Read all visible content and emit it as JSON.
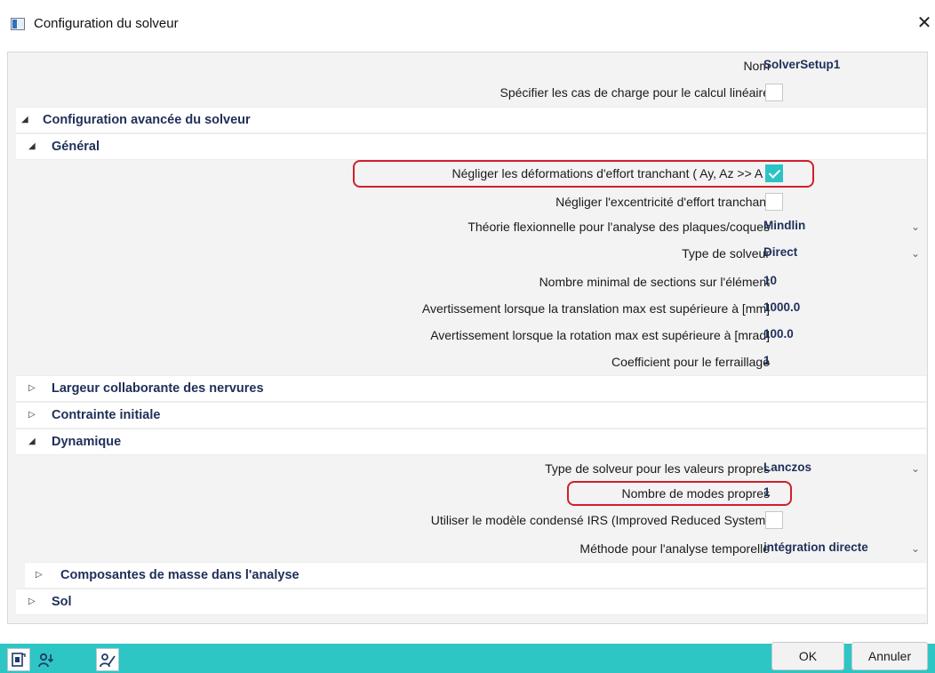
{
  "window": {
    "title": "Configuration du solveur",
    "close_glyph": "✕"
  },
  "general_props": [
    {
      "label": "Nom",
      "value": "SolverSetup1"
    },
    {
      "label": "Spécifier les cas de charge pour le calcul linéaire",
      "checked": false
    }
  ],
  "sections": {
    "advanced": "Configuration avancée du solveur",
    "general": "Général",
    "ribs": "Largeur collaborante des nervures",
    "initial_stress": "Contrainte initiale",
    "dynamic": "Dynamique",
    "mass": "Composantes de masse dans l'analyse",
    "soil": "Sol"
  },
  "general_items": [
    {
      "label": "Négliger les déformations d'effort tranchant ( Ay, Az >> A )",
      "checked": true
    },
    {
      "label": "Négliger l'excentricité d'effort tranchant",
      "checked": false
    },
    {
      "label": "Théorie flexionnelle pour l'analyse des plaques/coques",
      "value": "Mindlin"
    },
    {
      "label": "Type de solveur",
      "value": "Direct"
    },
    {
      "label": "Nombre minimal de sections sur l'élément",
      "value": "10"
    },
    {
      "label": "Avertissement lorsque la translation max est supérieure à [mm]",
      "value": "1000.0"
    },
    {
      "label": "Avertissement lorsque la rotation max est supérieure à [mrad]",
      "value": "100.0"
    },
    {
      "label": "Coefficient pour le ferraillage",
      "value": "1"
    }
  ],
  "dynamic_items": [
    {
      "label": "Type de solveur pour les valeurs propres",
      "value": "Lanczos"
    },
    {
      "label": "Nombre de modes propres",
      "value": "1"
    },
    {
      "label": "Utiliser le modèle condensé IRS (Improved Reduced System)",
      "checked": false
    },
    {
      "label": "Méthode pour l'analyse temporelle",
      "value": "intégration directe"
    }
  ],
  "glyphs": {
    "expanded": "◢",
    "collapsed": "▷",
    "dropdown": "⌄"
  },
  "icons": [
    "document-export-icon",
    "user-sort-icon",
    "user-edit-icon"
  ],
  "buttons": {
    "ok": "OK",
    "cancel": "Annuler"
  },
  "colors": {
    "accent": "#2dc6c4",
    "value_text": "#1f2f59",
    "highlight": "#d0202a"
  }
}
